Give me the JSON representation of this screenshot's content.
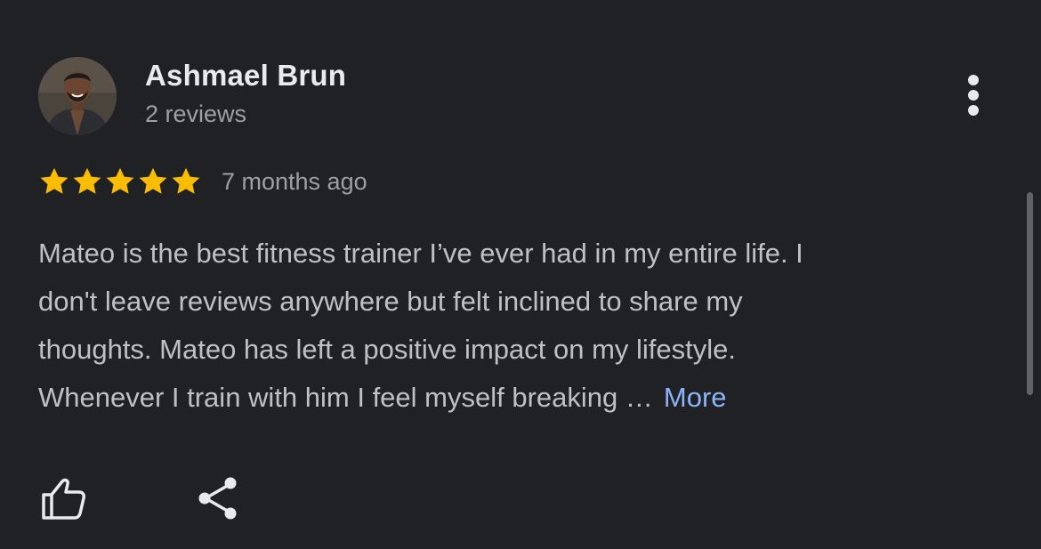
{
  "review": {
    "author": {
      "name": "Ashmael Brun",
      "meta": "2 reviews",
      "avatar_icon": "person-photo-avatar"
    },
    "rating": 5,
    "rating_max": 5,
    "date": "7 months ago",
    "text_lines": [
      "Mateo is the best fitness trainer I’ve ever had in my entire life. I",
      "don't leave reviews anywhere but felt inclined to share my",
      "thoughts. Mateo has left a positive impact on my lifestyle.",
      "Whenever I train with him I feel myself breaking …"
    ],
    "more_label": "More",
    "actions": {
      "like_icon": "thumbs-up-icon",
      "share_icon": "share-icon",
      "options_icon": "more-vertical-icon"
    }
  },
  "colors": {
    "background": "#202124",
    "name": "#e8eaed",
    "secondary_text": "#9aa0a6",
    "body_text": "#bdc1c6",
    "star": "#fbbc04",
    "link": "#8ab4f8",
    "scrollbar": "#5f6368"
  }
}
